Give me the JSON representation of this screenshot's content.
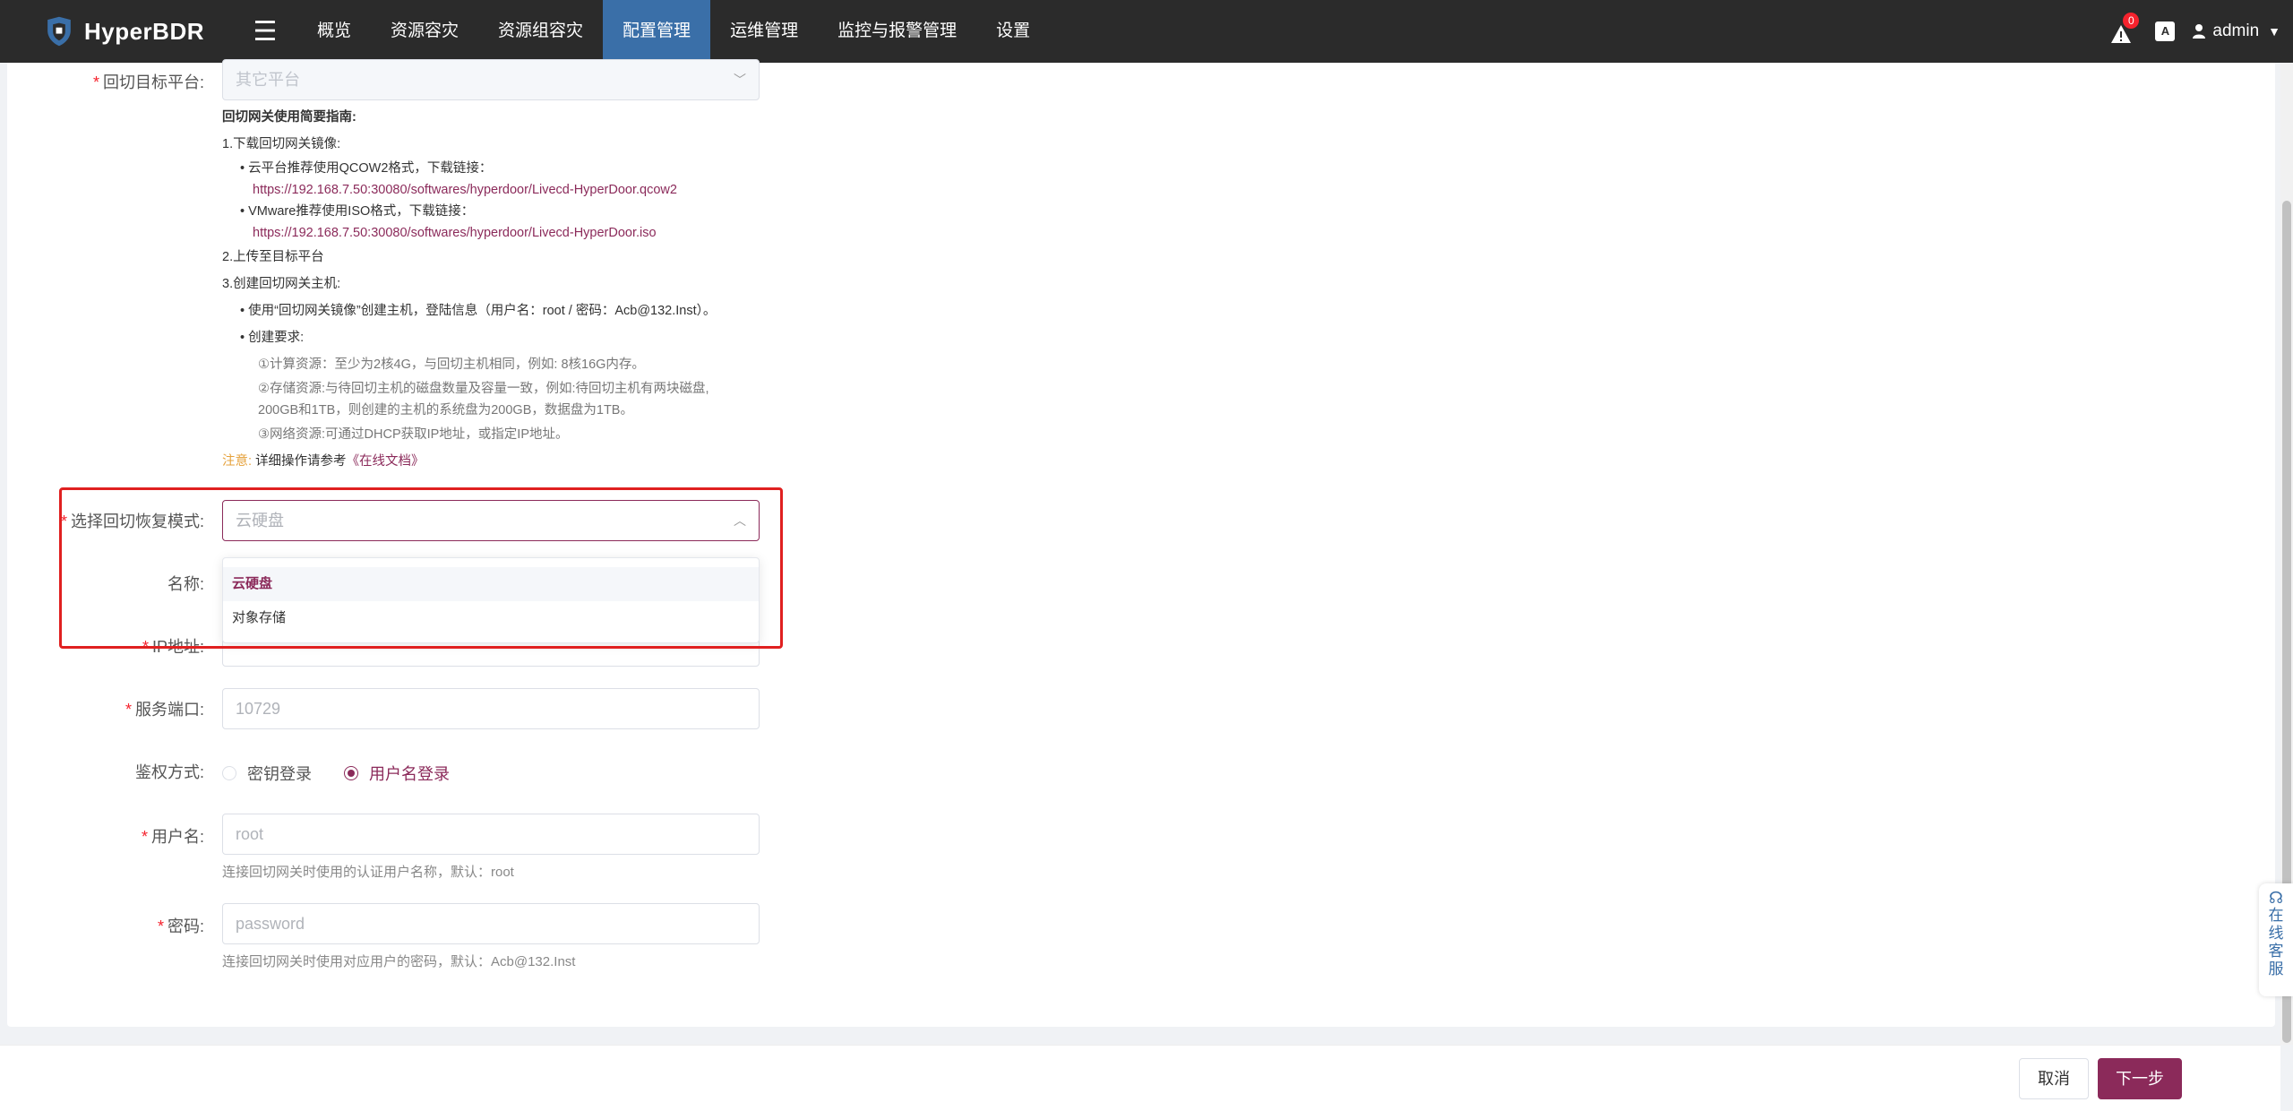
{
  "app": {
    "name": "HyperBDR"
  },
  "nav": {
    "items": [
      {
        "label": "概览"
      },
      {
        "label": "资源容灾"
      },
      {
        "label": "资源组容灾"
      },
      {
        "label": "配置管理"
      },
      {
        "label": "运维管理"
      },
      {
        "label": "监控与报警管理"
      },
      {
        "label": "设置"
      }
    ],
    "active_index": 3
  },
  "header_right": {
    "alert_count": "0",
    "lang_label": "A",
    "user": "admin"
  },
  "form": {
    "target_platform": {
      "label": "回切目标平台:",
      "value": "其它平台"
    },
    "guide": {
      "title": "回切网关使用简要指南:",
      "step1": "1.下载回切网关镜像:",
      "cloud_tip": "云平台推荐使用QCOW2格式，下载链接：",
      "cloud_link": "https://192.168.7.50:30080/softwares/hyperdoor/Livecd-HyperDoor.qcow2",
      "vmware_tip": "VMware推荐使用ISO格式，下载链接：",
      "vmware_link": "https://192.168.7.50:30080/softwares/hyperdoor/Livecd-HyperDoor.iso",
      "step2": "2.上传至目标平台",
      "step3": "3.创建回切网关主机:",
      "create_host": "使用“回切网关镜像”创建主机，登陆信息（用户名：root / 密码：Acb@132.Inst）。",
      "create_req": "创建要求:",
      "req_compute": "①计算资源：至少为2核4G，与回切主机相同，例如: 8核16G内存。",
      "req_storage_1": "②存储资源:与待回切主机的磁盘数量及容量一致，例如:待回切主机有两块磁盘,",
      "req_storage_2": "200GB和1TB，则创建的主机的系统盘为200GB，数据盘为1TB。",
      "req_network": "③网络资源:可通过DHCP获取IP地址，或指定IP地址。",
      "note_label": "注意:",
      "note_text": "详细操作请参考",
      "note_link": "《在线文档》"
    },
    "recovery_mode": {
      "label": "选择回切恢复模式:",
      "placeholder": "云硬盘",
      "options": [
        "云硬盘",
        "对象存储"
      ],
      "selected": "云硬盘"
    },
    "name": {
      "label": "名称:"
    },
    "ip": {
      "label": "IP地址:"
    },
    "port": {
      "label": "服务端口:",
      "placeholder": "10729"
    },
    "auth": {
      "label": "鉴权方式:",
      "options": [
        "密钥登录",
        "用户名登录"
      ],
      "selected_index": 1
    },
    "username": {
      "label": "用户名:",
      "placeholder": "root",
      "hint": "连接回切网关时使用的认证用户名称，默认：root"
    },
    "password": {
      "label": "密码:",
      "placeholder": "password",
      "hint": "连接回切网关时使用对应用户的密码，默认：Acb@132.Inst"
    }
  },
  "footer": {
    "cancel": "取消",
    "next": "下一步"
  },
  "support": {
    "label": "在线客服"
  }
}
